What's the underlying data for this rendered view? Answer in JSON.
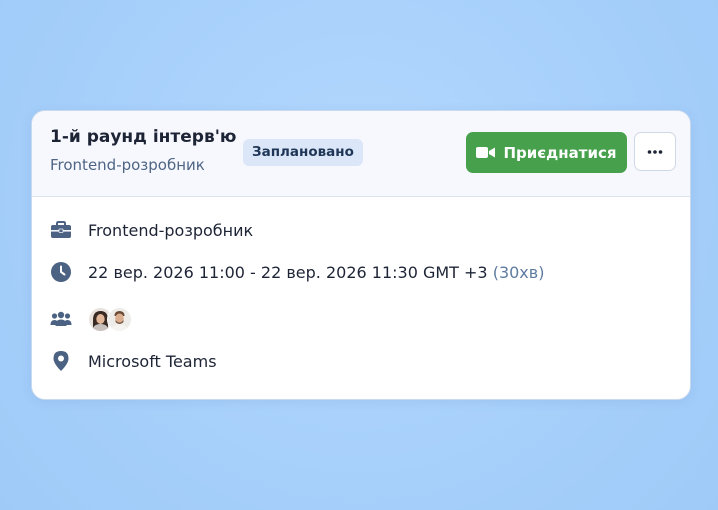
{
  "interview": {
    "title": "1-й раунд інтерв'ю",
    "subtitle": "Frontend-розробник",
    "status_badge": "Заплановано",
    "join_label": "Приєднатися"
  },
  "details": {
    "position": "Frontend-розробник",
    "datetime": "22 вер. 2026 11:00 - 22 вер. 2026 11:30 GMT +3",
    "duration": "(30хв)",
    "location": "Microsoft Teams"
  },
  "icons": {
    "join": "video-camera-icon",
    "more": "more-horizontal-icon",
    "position": "briefcase-icon",
    "datetime": "clock-icon",
    "participants": "users-icon",
    "location": "map-pin-icon"
  },
  "colors": {
    "background": "#a8d1fb",
    "join_button": "#47a04c",
    "badge_bg": "#dbe7f8",
    "icon": "#4b6283"
  }
}
